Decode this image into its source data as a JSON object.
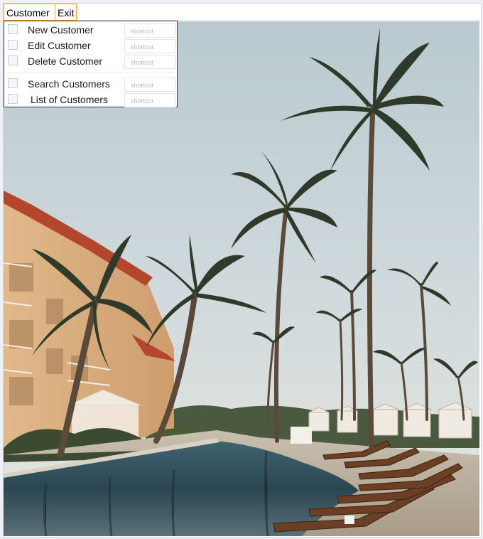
{
  "menubar": {
    "items": [
      {
        "label": "Customer"
      },
      {
        "label": "Exit"
      }
    ]
  },
  "dropdown": {
    "items": [
      {
        "label": "New Customer",
        "shortcut": "shortcut",
        "checked": false
      },
      {
        "label": "Edit Customer",
        "shortcut": "shortcut",
        "checked": false
      },
      {
        "label": "Delete Customer",
        "shortcut": "shortcut",
        "checked": false
      },
      {
        "label": "Search Customers",
        "shortcut": "shortcut",
        "checked": false
      },
      {
        "label": "List of Customers",
        "shortcut": "shortcut",
        "checked": false
      }
    ]
  },
  "colors": {
    "menu_highlight": "#f0a030",
    "dropdown_border": "#3a3a3a",
    "sky": "#c9d6db",
    "water": "#2e4a55"
  },
  "background_image": {
    "subject": "resort-pool-palm-trees"
  }
}
